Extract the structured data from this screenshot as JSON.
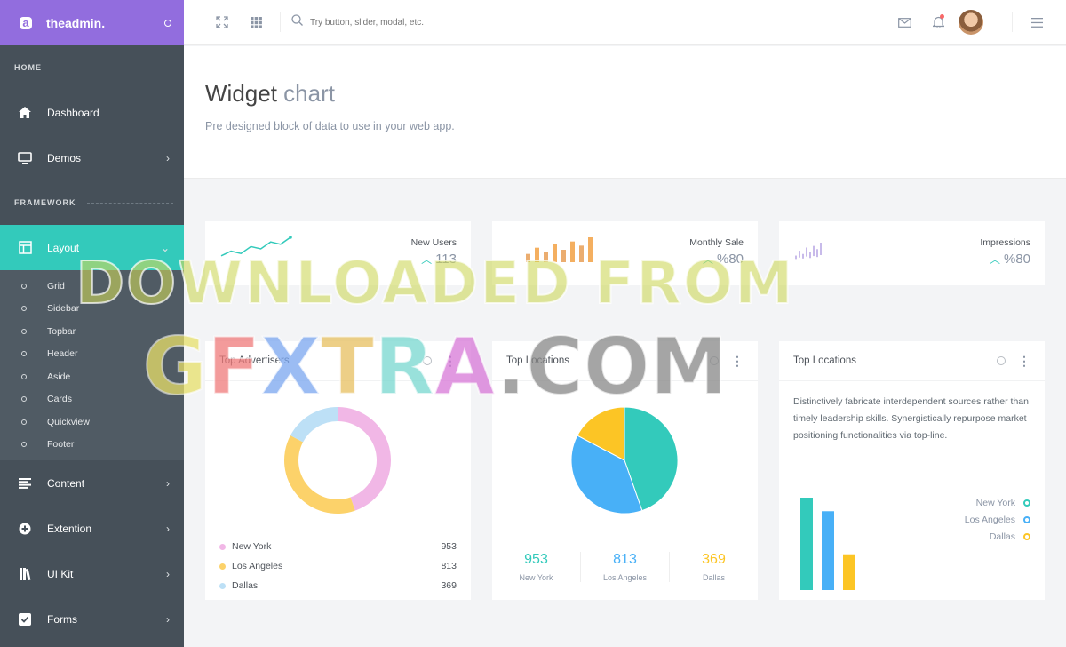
{
  "brand": {
    "logo_letter": "a",
    "name": "theadmin."
  },
  "sidebar": {
    "sections": [
      "HOME",
      "FRAMEWORK"
    ],
    "home_items": [
      {
        "label": "Dashboard",
        "icon": "home-icon"
      },
      {
        "label": "Demos",
        "icon": "monitor-icon"
      }
    ],
    "layout_item": {
      "label": "Layout",
      "icon": "layout-icon"
    },
    "layout_sub": [
      "Grid",
      "Sidebar",
      "Topbar",
      "Header",
      "Aside",
      "Cards",
      "Quickview",
      "Footer"
    ],
    "bottom_items": [
      {
        "label": "Content",
        "icon": "align-icon"
      },
      {
        "label": "Extention",
        "icon": "plus-circle-icon"
      },
      {
        "label": "UI Kit",
        "icon": "book-icon"
      },
      {
        "label": "Forms",
        "icon": "checkbox-icon"
      }
    ]
  },
  "topbar": {
    "search_placeholder": "Try button, slider, modal, etc."
  },
  "header": {
    "title_main": "Widget",
    "title_light": "chart",
    "subtitle": "Pre designed block of data to use in your web app."
  },
  "stats": [
    {
      "title": "New Users",
      "value": "113"
    },
    {
      "title": "Monthly Sale",
      "value": "%80"
    },
    {
      "title": "Impressions",
      "value": "%80"
    }
  ],
  "cards": {
    "c1_title": "Top Advertisers",
    "c2_title": "Top Locations",
    "c3_title": "Top Locations",
    "c3_text": "Distinctively fabricate interdependent sources rather than timely leadership skills. Synergistically repurpose market positioning functionalities via top-line."
  },
  "locations": [
    {
      "name": "New York",
      "value": "953"
    },
    {
      "name": "Los Angeles",
      "value": "813"
    },
    {
      "name": "Dallas",
      "value": "369"
    }
  ],
  "watermark": {
    "line1": "DOWNLOADED FROM",
    "line2": "GFXTRA.COM"
  },
  "colors": {
    "primary": "#926dde",
    "teal": "#33cabb",
    "blue": "#48b0f7",
    "yellow": "#fcc525",
    "pink": "#f2a6e5"
  },
  "chart_data": [
    {
      "type": "pie",
      "name": "donut",
      "categories": [
        "New York",
        "Los Angeles",
        "Dallas"
      ],
      "values": [
        953,
        813,
        369
      ],
      "colors": [
        "#f1b7e6",
        "#fcd26a",
        "#bde0f6"
      ]
    },
    {
      "type": "pie",
      "categories": [
        "New York",
        "Los Angeles",
        "Dallas"
      ],
      "values": [
        953,
        813,
        369
      ],
      "colors": [
        "#33cabb",
        "#48b0f7",
        "#fcc525"
      ]
    },
    {
      "type": "bar",
      "categories": [
        "New York",
        "Los Angeles",
        "Dallas"
      ],
      "values": [
        953,
        813,
        369
      ],
      "colors": [
        "#33cabb",
        "#48b0f7",
        "#fcc525"
      ]
    },
    {
      "type": "line",
      "values": [
        2,
        4,
        3,
        6,
        5,
        8,
        7,
        10
      ]
    },
    {
      "type": "bar",
      "values": [
        4,
        7,
        5,
        9,
        6,
        10,
        8,
        12
      ]
    },
    {
      "type": "bar",
      "values": [
        3,
        6,
        4,
        8,
        5,
        9,
        7,
        11
      ]
    }
  ]
}
